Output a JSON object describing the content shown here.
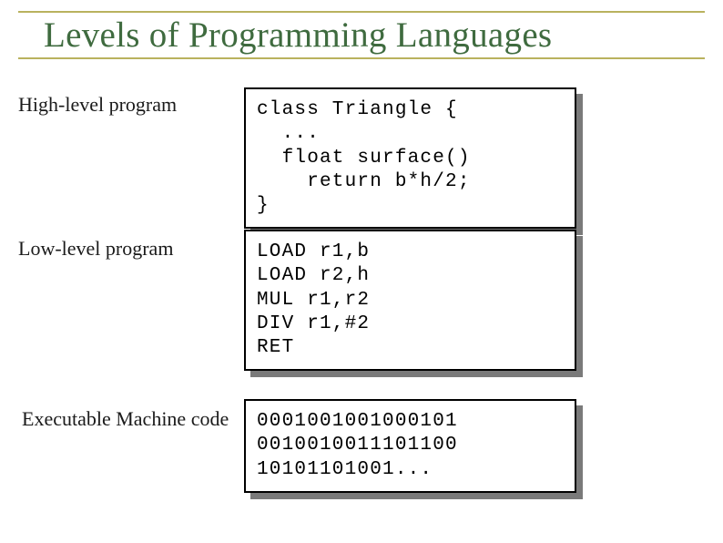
{
  "title": "Levels of Programming Languages",
  "sections": {
    "high": {
      "label": "High-level program",
      "code": "class Triangle {\n  ...\n  float surface()\n    return b*h/2;\n}"
    },
    "low": {
      "label": "Low-level program",
      "code": "LOAD r1,b\nLOAD r2,h\nMUL r1,r2\nDIV r1,#2\nRET"
    },
    "machine": {
      "label": "Executable Machine code",
      "code": "0001001001000101\n0010010011101100\n10101101001..."
    }
  }
}
